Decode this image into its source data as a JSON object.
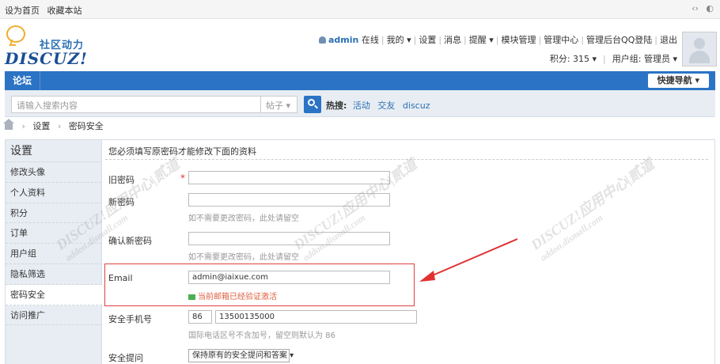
{
  "topbar": {
    "set_home": "设为首页",
    "bookmark": "收藏本站",
    "right_icons": [
      "‹›",
      "◐"
    ]
  },
  "logo": {
    "cn_text": "社区动力",
    "en_text": "DISCUZ!"
  },
  "user_nav": {
    "username": "admin",
    "status": "在线",
    "items": [
      "我的 ▾",
      "设置",
      "消息",
      "提醒 ▾",
      "模块管理",
      "管理中心",
      "管理后台QQ登陆",
      "退出"
    ],
    "credits": "积分: 315 ▾",
    "usergroup": "用户组: 管理员 ▾"
  },
  "navbar": {
    "forum": "论坛",
    "quick_nav": "快捷导航 ▾"
  },
  "search": {
    "placeholder": "请输入搜索内容",
    "type": "帖子 ▾",
    "hot_label": "热搜:",
    "hot_terms": [
      "活动",
      "交友",
      "discuz"
    ]
  },
  "breadcrumb": {
    "items": [
      "设置",
      "密码安全"
    ]
  },
  "sidebar": {
    "title": "设置",
    "items": [
      "修改头像",
      "个人资料",
      "积分",
      "订单",
      "用户组",
      "隐私筛选",
      "密码安全",
      "访问推广"
    ],
    "active_index": 6
  },
  "form": {
    "notice": "您必须填写原密码才能修改下面的资料",
    "old_password_label": "旧密码",
    "required_mark": "*",
    "new_password_label": "新密码",
    "new_password_hint": "如不需要更改密码，此处请留空",
    "confirm_password_label": "确认新密码",
    "confirm_password_hint": "如不需要更改密码，此处请留空",
    "email_label": "Email",
    "email_value": "admin@iaixue.com",
    "email_status": "当前邮箱已经验证激活",
    "phone_label": "安全手机号",
    "phone_code": "86",
    "phone_number": "13500135000",
    "phone_hint": "国际电话区号不含加号，留空则默认为 86",
    "question_label": "安全提问",
    "question_value": "保持原有的安全提问和答案 ▾"
  },
  "watermark": {
    "text1": "DISCUZ!应用中心|贰道",
    "text2": "addon.dismall.com"
  },
  "colors": {
    "nav_blue": "#2b73c4",
    "highlight_red": "#e04040",
    "link_blue": "#2b6fb3"
  }
}
